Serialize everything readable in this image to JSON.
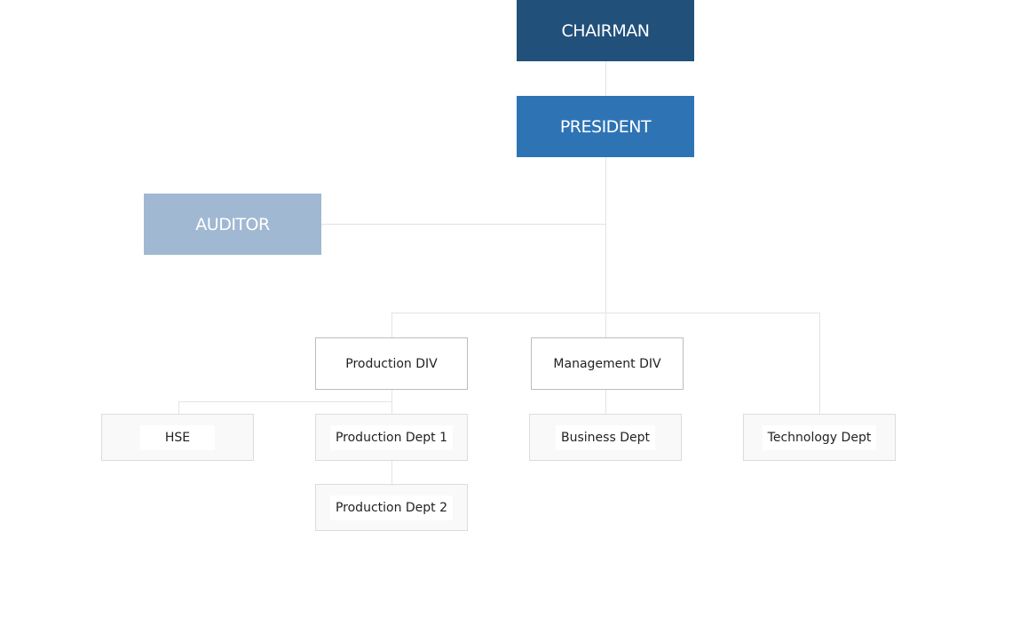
{
  "colors": {
    "chairman": "#21507a",
    "president": "#2e74b5",
    "auditor": "#a1b8d2"
  },
  "chairman": "CHAIRMAN",
  "president": "PRESIDENT",
  "auditor": "AUDITOR",
  "divisions": [
    "Production DIV",
    "Management DIV"
  ],
  "departments": {
    "hse": "HSE",
    "production_1": "Production Dept 1",
    "production_2": "Production Dept 2",
    "business": "Business Dept",
    "technology": "Technology Dept"
  }
}
